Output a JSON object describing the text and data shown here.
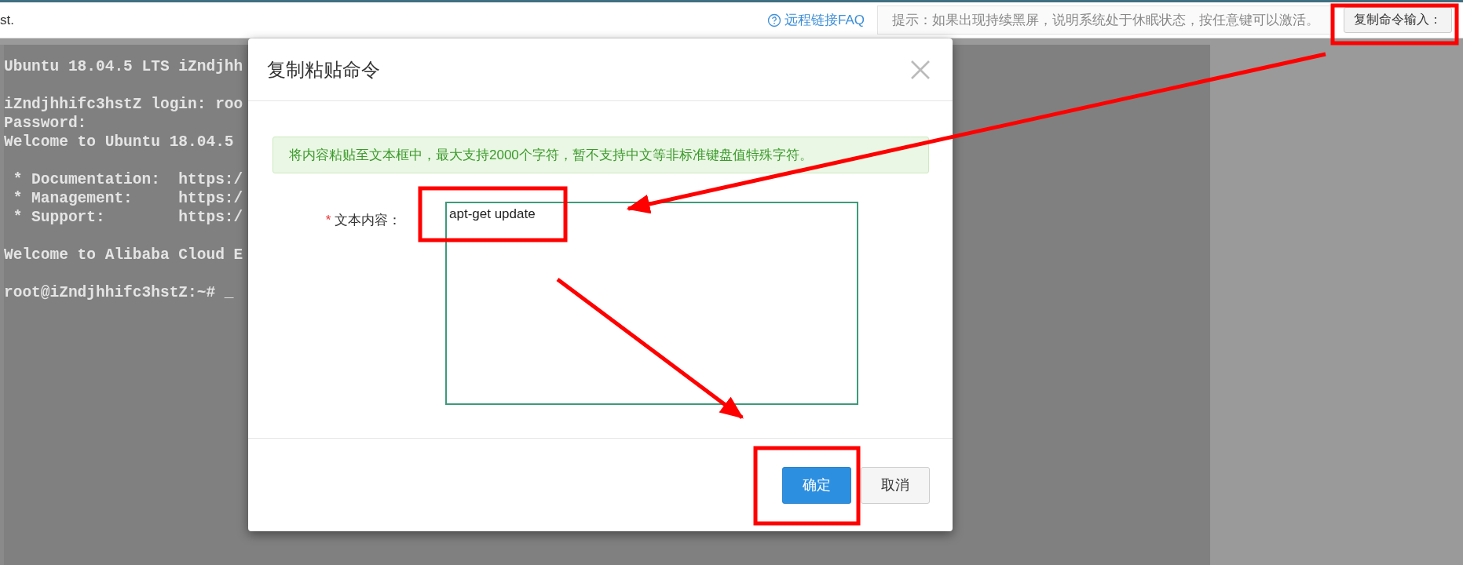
{
  "top_bar": {
    "title_fragment": "st.",
    "faq_link": "远程链接FAQ",
    "hint": "提示：如果出现持续黑屏，说明系统处于休眠状态，按任意键可以激活。",
    "copy_button": "复制命令输入："
  },
  "terminal": {
    "blocks": [
      [
        "Ubuntu 18.04.5 LTS iZndjhh"
      ],
      [
        "iZndjhhifc3hstZ login: roo",
        "Password:",
        "Welcome to Ubuntu 18.04.5"
      ],
      [
        " * Documentation:  https:/",
        " * Management:     https:/",
        " * Support:        https:/"
      ],
      [
        "Welcome to Alibaba Cloud E"
      ],
      [
        "root@iZndjhhifc3hstZ:~# _"
      ]
    ]
  },
  "dialog": {
    "title": "复制粘贴命令",
    "alert": "将内容粘贴至文本框中，最大支持2000个字符，暂不支持中文等非标准键盘值特殊字符。",
    "field": {
      "required_mark": "*",
      "label": "文本内容：",
      "value": "apt-get update"
    },
    "buttons": [
      {
        "label": "确定",
        "kind": "primary"
      },
      {
        "label": "取消",
        "kind": "default"
      }
    ]
  }
}
